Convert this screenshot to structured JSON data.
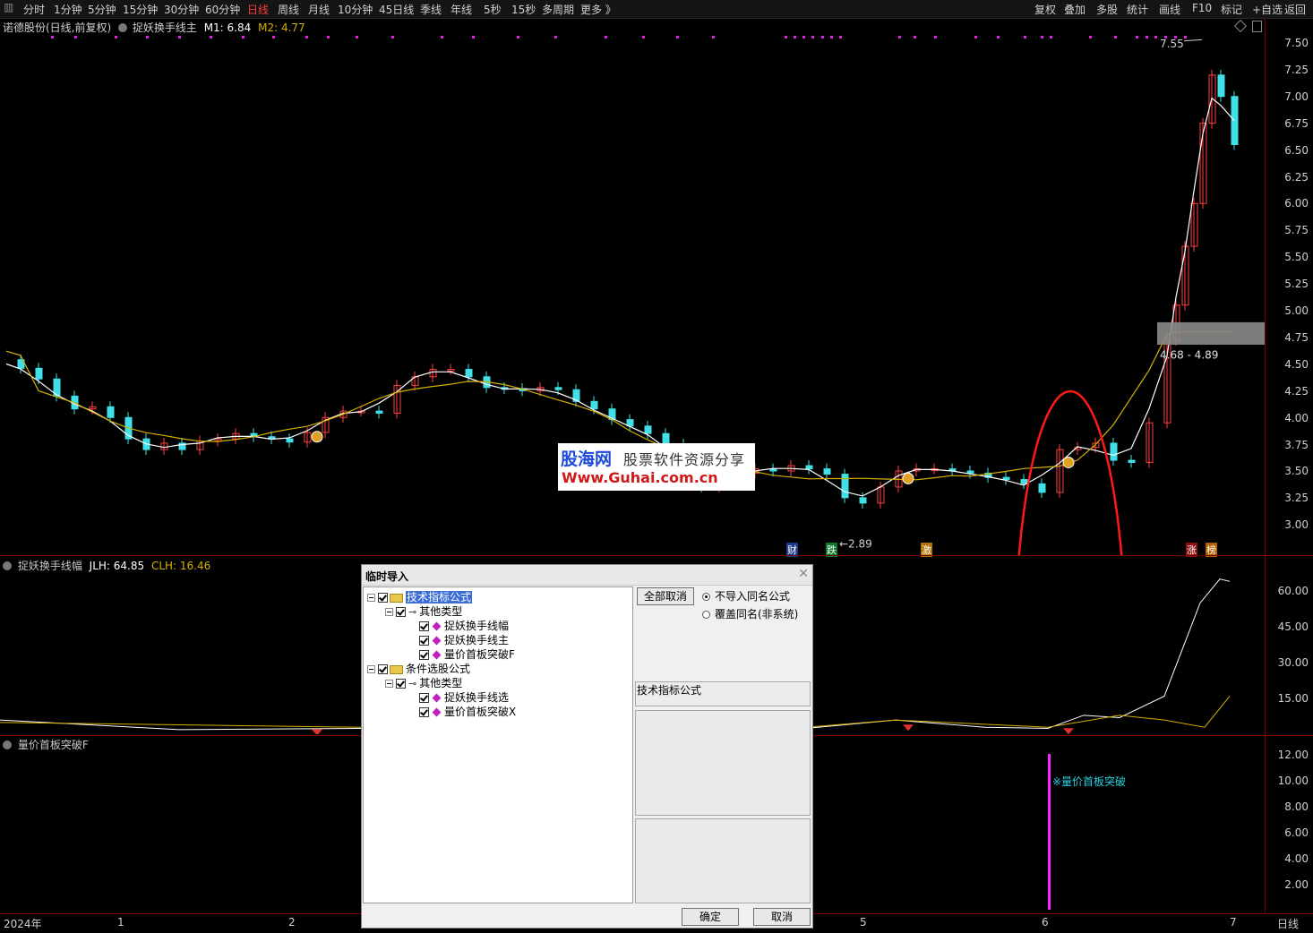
{
  "toolbar": {
    "left_items": [
      "分时",
      "1分钟",
      "5分钟",
      "15分钟",
      "30分钟",
      "60分钟",
      "日线",
      "周线",
      "月线",
      "10分钟",
      "45日线",
      "季线",
      "年线",
      "5秒",
      "15秒",
      "多周期",
      "更多 》"
    ],
    "active_item": "日线",
    "right_items": [
      "复权",
      "叠加",
      "多股",
      "统计",
      "画线",
      "F10",
      "标记",
      "+自选",
      "返回"
    ]
  },
  "main_panel": {
    "stock_title": "诺德股份(日线,前复权)",
    "indicator_name": "捉妖换手线主",
    "m1_label": "M1: 6.84",
    "m2_label": "M2: 4.77",
    "y_ticks": [
      "7.50",
      "7.25",
      "7.00",
      "6.75",
      "6.50",
      "6.25",
      "6.00",
      "5.75",
      "5.50",
      "5.25",
      "5.00",
      "4.75",
      "4.50",
      "4.25",
      "4.00",
      "3.75",
      "3.50",
      "3.25",
      "3.00"
    ],
    "high_label": "7.55",
    "low_label": "2.89",
    "range_box_label": "4.68 - 4.89",
    "event_markers": [
      "财",
      "跌",
      "激",
      "涨",
      "榜"
    ],
    "colors": {
      "up": "#ff4040",
      "down": "#40e0e8",
      "ma_short": "#ffffff",
      "ma_long": "#d4b000",
      "highlight_ellipse": "#ff1a1a"
    }
  },
  "sub_panel_1": {
    "indicator_name": "捉妖换手线幅",
    "jlh_label": "JLH: 64.85",
    "clh_label": "CLH: 16.46",
    "y_ticks": [
      "60.00",
      "45.00",
      "30.00",
      "15.00"
    ]
  },
  "sub_panel_2": {
    "indicator_name": "量价首板突破F",
    "signal_label": "※量价首板突破",
    "y_ticks": [
      "12.00",
      "10.00",
      "8.00",
      "6.00",
      "4.00",
      "2.00"
    ]
  },
  "x_axis": {
    "labels": [
      "2024年",
      "1",
      "2",
      "5",
      "6",
      "7"
    ],
    "period": "日线"
  },
  "watermark": {
    "brand": "股海网",
    "slogan": "股票软件资源分享",
    "url": "Www.Guhai.com.cn"
  },
  "dialog": {
    "title": "临时导入",
    "tree": {
      "group1": "技术指标公式",
      "group1_sub": "其他类型",
      "group1_items": [
        "捉妖换手线幅",
        "捉妖换手线主",
        "量价首板突破F"
      ],
      "group2": "条件选股公式",
      "group2_sub": "其他类型",
      "group2_items": [
        "捉妖换手线选",
        "量价首板突破X"
      ]
    },
    "deselect_all_button": "全部取消",
    "radio_options": [
      "不导入同名公式",
      "覆盖同名(非系统)"
    ],
    "selected_radio": "不导入同名公式",
    "detail_label": "技术指标公式",
    "ok_button": "确定",
    "cancel_button": "取消"
  }
}
